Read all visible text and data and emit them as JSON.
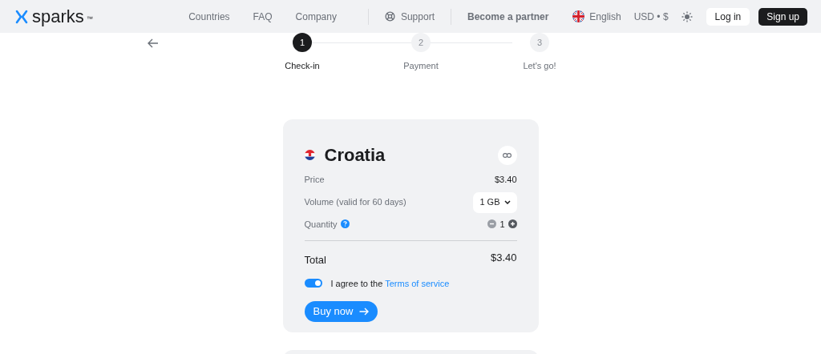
{
  "header": {
    "logo": "sparks",
    "logo_mark": "™",
    "nav": [
      {
        "label": "Countries",
        "kind": "link"
      },
      {
        "label": "FAQ",
        "kind": "link"
      },
      {
        "label": "Company",
        "kind": "link"
      },
      {
        "label": "Support",
        "kind": "support"
      },
      {
        "label": "Become a partner",
        "kind": "partner"
      }
    ],
    "language": "English",
    "currency": "USD • $",
    "login": "Log in",
    "signup": "Sign up"
  },
  "steps": [
    {
      "number": "1",
      "label": "Check-in",
      "selected": true
    },
    {
      "number": "2",
      "label": "Payment",
      "selected": false
    },
    {
      "number": "3",
      "label": "Let's go!",
      "selected": false
    }
  ],
  "card": {
    "country": "Croatia",
    "price_label": "Price",
    "price": "$3.40",
    "volume_label": "Volume (valid for 60 days)",
    "volume": "1 GB",
    "quantity_label": "Quantity",
    "quantity": "1",
    "total_label": "Total",
    "total": "$3.40",
    "agree": {
      "on": true,
      "text": "I agree to the ",
      "link": "Terms of service"
    },
    "buy": "Buy now"
  }
}
